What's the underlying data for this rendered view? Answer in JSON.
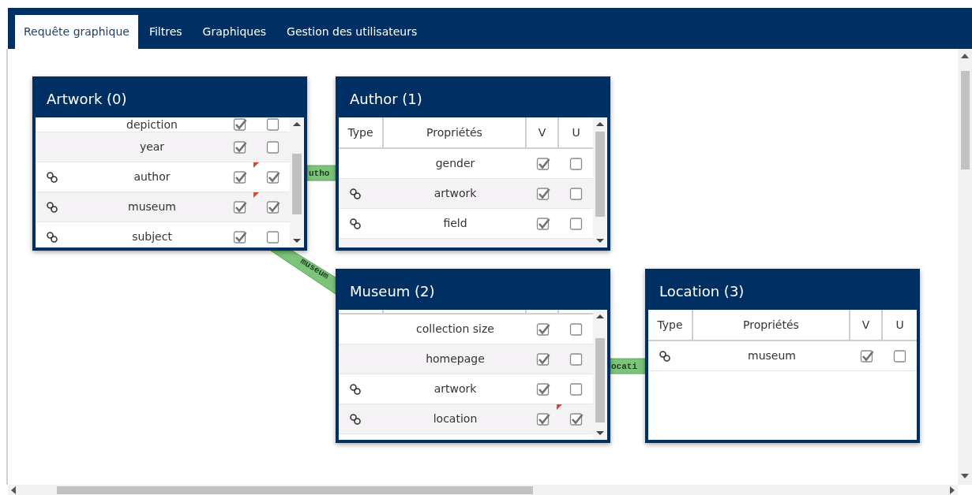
{
  "tabs": [
    {
      "label": "Requête graphique",
      "selected": true
    },
    {
      "label": "Filtres",
      "selected": false
    },
    {
      "label": "Graphiques",
      "selected": false
    },
    {
      "label": "Gestion des utilisateurs",
      "selected": false
    }
  ],
  "edges": [
    {
      "label": "utho"
    },
    {
      "label": "museum"
    },
    {
      "label": "ocati"
    }
  ],
  "nodes": [
    {
      "title": "Artwork (0)",
      "rows": [
        {
          "link": false,
          "property": "depiction",
          "v": true,
          "u": false
        },
        {
          "link": false,
          "property": "year",
          "v": true,
          "u": false
        },
        {
          "link": true,
          "property": "author",
          "v": true,
          "u": true
        },
        {
          "link": true,
          "property": "museum",
          "v": true,
          "u": true
        },
        {
          "link": true,
          "property": "subject",
          "v": true,
          "u": false
        }
      ]
    },
    {
      "title": "Author (1)",
      "columns": [
        "Type",
        "Propriétés",
        "V",
        "U"
      ],
      "rows": [
        {
          "link": false,
          "property": "gender",
          "v": true,
          "u": false
        },
        {
          "link": true,
          "property": "artwork",
          "v": true,
          "u": false
        },
        {
          "link": true,
          "property": "field",
          "v": true,
          "u": false
        }
      ]
    },
    {
      "title": "Museum (2)",
      "rows": [
        {
          "link": false,
          "property": "collection size",
          "v": true,
          "u": false
        },
        {
          "link": false,
          "property": "homepage",
          "v": true,
          "u": false
        },
        {
          "link": true,
          "property": "artwork",
          "v": true,
          "u": false
        },
        {
          "link": true,
          "property": "location",
          "v": true,
          "u": true
        }
      ]
    },
    {
      "title": "Location (3)",
      "columns": [
        "Type",
        "Propriétés",
        "V",
        "U"
      ],
      "rows": [
        {
          "link": true,
          "property": "museum",
          "v": true,
          "u": false
        }
      ]
    }
  ]
}
